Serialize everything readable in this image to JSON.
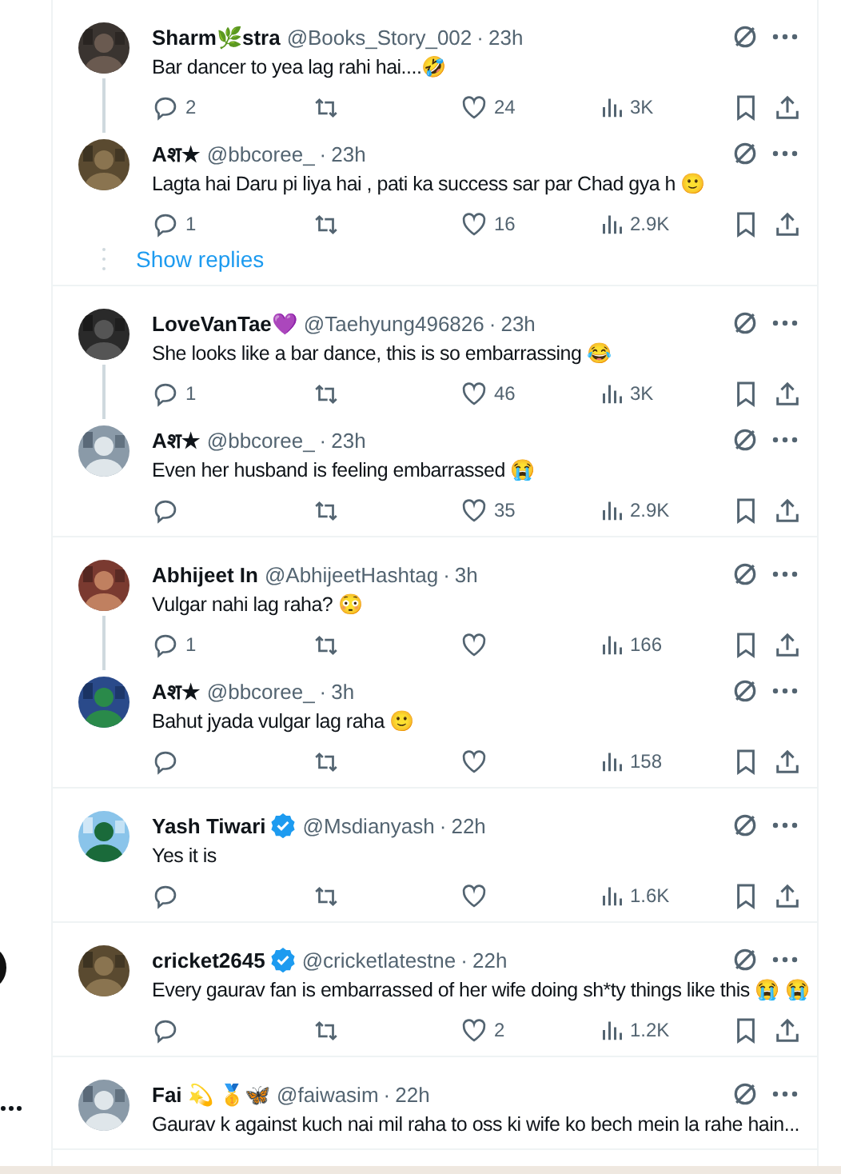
{
  "threads": [
    {
      "tweets": [
        {
          "name": "Sharm🌿stra",
          "verified": false,
          "handle": "@Books_Story_002",
          "separator": "·",
          "time": "23h",
          "text": "Bar dancer to yea lag rahi hai....🤣",
          "replies": "2",
          "likes": "24",
          "views": "3K"
        },
        {
          "name": "Aश★",
          "verified": false,
          "handle": "@bbcoree_",
          "separator": "·",
          "time": "23h",
          "text": "Lagta hai Daru pi liya hai , pati ka success sar par Chad gya h 🙂",
          "replies": "1",
          "likes": "16",
          "views": "2.9K"
        }
      ],
      "show_replies": "Show replies"
    },
    {
      "tweets": [
        {
          "name": "LoveVanTae💜",
          "verified": false,
          "handle": "@Taehyung496826",
          "separator": "·",
          "time": "23h",
          "text": "She looks like a bar dance, this is so embarrassing 😂",
          "replies": "1",
          "likes": "46",
          "views": "3K"
        },
        {
          "name": "Aश★",
          "verified": false,
          "handle": "@bbcoree_",
          "separator": "·",
          "time": "23h",
          "text": "Even her husband is feeling embarrassed 😭",
          "likes": "35",
          "views": "2.9K"
        }
      ]
    },
    {
      "tweets": [
        {
          "name": "Abhijeet In",
          "verified": false,
          "handle": "@AbhijeetHashtag",
          "separator": "·",
          "time": "3h",
          "text": "Vulgar nahi lag raha? 😳",
          "replies": "1",
          "views": "166"
        },
        {
          "name": "Aश★",
          "verified": false,
          "handle": "@bbcoree_",
          "separator": "·",
          "time": "3h",
          "text": "Bahut jyada vulgar lag raha 🙂",
          "views": "158"
        }
      ]
    },
    {
      "tweets": [
        {
          "name": "Yash Tiwari",
          "verified": true,
          "handle": "@Msdianyash",
          "separator": "·",
          "time": "22h",
          "text": "Yes it is",
          "views": "1.6K"
        }
      ]
    },
    {
      "tweets": [
        {
          "name": "cricket2645",
          "verified": true,
          "handle": "@cricketlatestne",
          "separator": "·",
          "time": "22h",
          "text": "Every gaurav fan is embarrassed of her wife doing sh*ty things like this 😭 😭",
          "likes": "2",
          "views": "1.2K"
        }
      ]
    },
    {
      "tweets": [
        {
          "name": "Fai 💫 🥇🦋",
          "verified": false,
          "handle": "@faiwasim",
          "separator": "·",
          "time": "22h",
          "text": "Gaurav k against kuch nai mil raha to oss ki wife ko bech mein la rahe hain..."
        }
      ]
    }
  ]
}
